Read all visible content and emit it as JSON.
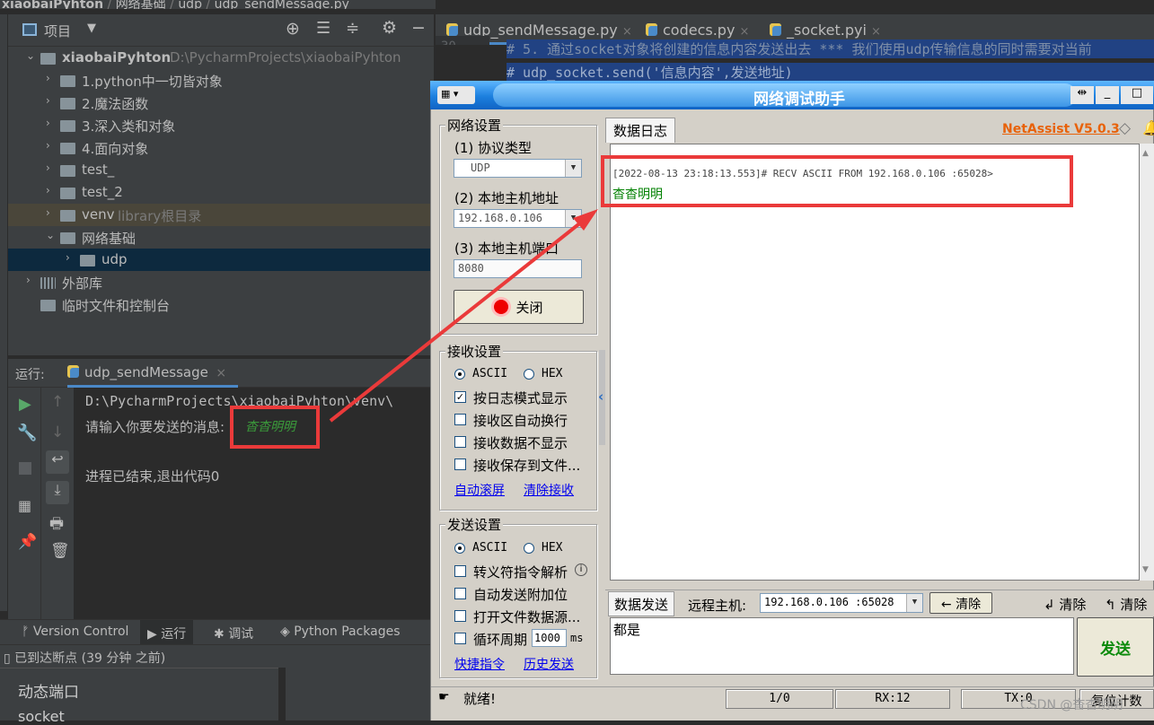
{
  "ide": {
    "breadcrumb": [
      "xiaobaiPyhton",
      "网络基础",
      "udp",
      "udp_sendMessage.py"
    ],
    "project_panel": {
      "title": "项目",
      "tree": [
        {
          "label": "xiaobaiPyhton",
          "hint": "D:\\PycharmProjects\\xiaobaiPyhton",
          "arrow": "⌄",
          "level": 0
        },
        {
          "label": "1.python中一切皆对象",
          "arrow": "›",
          "level": 1
        },
        {
          "label": "2.魔法函数",
          "arrow": "›",
          "level": 1
        },
        {
          "label": "3.深入类和对象",
          "arrow": "›",
          "level": 1
        },
        {
          "label": "4.面向对象",
          "arrow": "›",
          "level": 1
        },
        {
          "label": "test_",
          "arrow": "›",
          "level": 1
        },
        {
          "label": "test_2",
          "arrow": "›",
          "level": 1
        },
        {
          "label": "venv",
          "hint": "library根目录",
          "arrow": "›",
          "level": 1
        },
        {
          "label": "网络基础",
          "arrow": "⌄",
          "level": 1
        },
        {
          "label": "udp",
          "arrow": "›",
          "level": 2
        },
        {
          "label": "外部库",
          "arrow": "›",
          "level": 0
        },
        {
          "label": "临时文件和控制台",
          "arrow": "",
          "level": 0
        }
      ]
    },
    "editor_tabs": [
      {
        "label": "udp_sendMessage.py"
      },
      {
        "label": "codecs.py"
      },
      {
        "label": "_socket.pyi"
      }
    ],
    "code_lines": [
      {
        "num": "30",
        "text": "# 5. 通过socket对象将创建的信息内容发送出去   *** 我们使用udp传输信息的同时需要对当前"
      },
      {
        "num": "31",
        "text": "# udp_socket.send('信息内容',发送地址)"
      }
    ],
    "run_panel": {
      "label": "运行:",
      "tab": "udp_sendMessage",
      "console": [
        "D:\\PycharmProjects\\xiaobaiPyhton\\venv\\",
        "请输入你要发送的消息:",
        "",
        "进程已结束,退出代码0"
      ],
      "input_value": "杳杳明明"
    },
    "bottom_tabs": [
      "Version Control",
      "运行",
      "调试",
      "Python Packages"
    ],
    "status_text": "已到达断点 (39 分钟 之前)",
    "popup_items": [
      "动态端口",
      "socket"
    ]
  },
  "netassist": {
    "title": "网络调试助手",
    "brand": "NetAssist V5.0.3",
    "network_settings": {
      "title": "网络设置",
      "protocol_label": "(1) 协议类型",
      "protocol_value": "UDP",
      "host_label": "(2) 本地主机地址",
      "host_value": "192.168.0.106",
      "port_label": "(3) 本地主机端口",
      "port_value": "8080",
      "close_button": "关闭"
    },
    "recv_settings": {
      "title": "接收设置",
      "ascii": "ASCII",
      "hex": "HEX",
      "options": [
        "按日志模式显示",
        "接收区自动换行",
        "接收数据不显示",
        "接收保存到文件..."
      ],
      "checked": [
        true,
        false,
        false,
        false
      ],
      "link_autoscroll": "自动滚屏",
      "link_clear": "清除接收"
    },
    "send_settings": {
      "title": "发送设置",
      "ascii": "ASCII",
      "hex": "HEX",
      "options": [
        "转义符指令解析",
        "自动发送附加位",
        "打开文件数据源...",
        "循环周期"
      ],
      "cycle_value": "1000",
      "cycle_unit": "ms",
      "link_shortcut": "快捷指令",
      "link_history": "历史发送"
    },
    "log_tab": "数据日志",
    "log_header": "[2022-08-13 23:18:13.553]# RECV ASCII FROM 192.168.0.106 :65028>",
    "log_message": "杳杳明明",
    "send_bar": {
      "tab": "数据发送",
      "remote_label": "远程主机:",
      "remote_value": "192.168.0.106 :65028",
      "clear_button": "清除",
      "clear2": "清除",
      "clear3": "清除"
    },
    "send_text": "都是",
    "send_button": "发送",
    "status": {
      "ready": "就绪!",
      "counter": "1/0",
      "rx": "RX:12",
      "tx": "TX:0",
      "reset": "复位计数"
    }
  },
  "watermark": "CSDN @杳杳明明",
  "colors": {
    "highlight_red": "#ea3a3a",
    "message_green": "#008000"
  }
}
